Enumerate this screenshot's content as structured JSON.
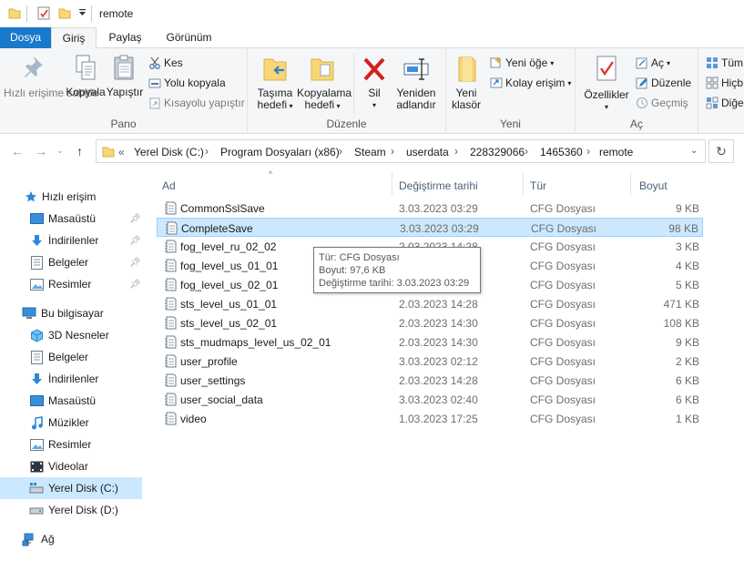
{
  "window": {
    "title": "remote"
  },
  "menu": {
    "file": "Dosya",
    "home": "Giriş",
    "share": "Paylaş",
    "view": "Görünüm"
  },
  "ribbon": {
    "pano": {
      "label": "Pano",
      "pin": "Hızlı erişime sabitle",
      "copy": "Kopyala",
      "paste": "Yapıştır",
      "cut": "Kes",
      "copy_path": "Yolu kopyala",
      "paste_shortcut": "Kısayolu yapıştır"
    },
    "duzenle": {
      "label": "Düzenle",
      "move_to_1": "Taşıma",
      "move_to_2": "hedefi",
      "copy_to_1": "Kopyalama",
      "copy_to_2": "hedefi",
      "delete": "Sil",
      "rename_1": "Yeniden",
      "rename_2": "adlandır"
    },
    "yeni": {
      "label": "Yeni",
      "new_folder_1": "Yeni",
      "new_folder_2": "klasör",
      "new_item": "Yeni öğe",
      "easy_access": "Kolay erişim"
    },
    "ac": {
      "label": "Aç",
      "properties": "Özellikler",
      "open": "Aç",
      "edit": "Düzenle",
      "history": "Geçmiş"
    },
    "sec": {
      "all": "Tüm",
      "none": "Hiçb",
      "invert": "Diğe"
    }
  },
  "address": {
    "overflow": "«",
    "crumbs": [
      "Yerel Disk (C:)",
      "Program Dosyaları (x86)",
      "Steam",
      "userdata",
      "228329066",
      "1465360",
      "remote"
    ]
  },
  "sidebar": {
    "quick_access": "Hızlı erişim",
    "quick": [
      "Masaüstü",
      "İndirilenler",
      "Belgeler",
      "Resimler"
    ],
    "this_pc": "Bu bilgisayar",
    "pc": [
      "3D Nesneler",
      "Belgeler",
      "İndirilenler",
      "Masaüstü",
      "Müzikler",
      "Resimler",
      "Videolar",
      "Yerel Disk (C:)",
      "Yerel Disk (D:)"
    ],
    "network": "Ağ"
  },
  "columns": {
    "name": "Ad",
    "date": "Değiştirme tarihi",
    "type": "Tür",
    "size": "Boyut"
  },
  "files": [
    {
      "name": "CommonSslSave",
      "date": "3.03.2023 03:29",
      "type": "CFG Dosyası",
      "size": "9 KB"
    },
    {
      "name": "CompleteSave",
      "date": "3.03.2023 03:29",
      "type": "CFG Dosyası",
      "size": "98 KB"
    },
    {
      "name": "fog_level_ru_02_02",
      "date": "2.03.2023 14:28",
      "type": "CFG Dosyası",
      "size": "3 KB"
    },
    {
      "name": "fog_level_us_01_01",
      "date": "",
      "type": "CFG Dosyası",
      "size": "4 KB"
    },
    {
      "name": "fog_level_us_02_01",
      "date": "",
      "type": "CFG Dosyası",
      "size": "5 KB"
    },
    {
      "name": "sts_level_us_01_01",
      "date": "2.03.2023 14:28",
      "type": "CFG Dosyası",
      "size": "471 KB"
    },
    {
      "name": "sts_level_us_02_01",
      "date": "2.03.2023 14:30",
      "type": "CFG Dosyası",
      "size": "108 KB"
    },
    {
      "name": "sts_mudmaps_level_us_02_01",
      "date": "2.03.2023 14:30",
      "type": "CFG Dosyası",
      "size": "9 KB"
    },
    {
      "name": "user_profile",
      "date": "3.03.2023 02:12",
      "type": "CFG Dosyası",
      "size": "2 KB"
    },
    {
      "name": "user_settings",
      "date": "2.03.2023 14:28",
      "type": "CFG Dosyası",
      "size": "6 KB"
    },
    {
      "name": "user_social_data",
      "date": "3.03.2023 02:40",
      "type": "CFG Dosyası",
      "size": "6 KB"
    },
    {
      "name": "video",
      "date": "1.03.2023 17:25",
      "type": "CFG Dosyası",
      "size": "1 KB"
    }
  ],
  "tooltip": {
    "type": "Tür: CFG Dosyası",
    "size": "Boyut: 97,6 KB",
    "modified": "Değiştirme tarihi: 3.03.2023 03:29"
  },
  "colors": {
    "accent": "#1979ca",
    "selection": "#cce8ff",
    "selection_border": "#99d1ff"
  }
}
